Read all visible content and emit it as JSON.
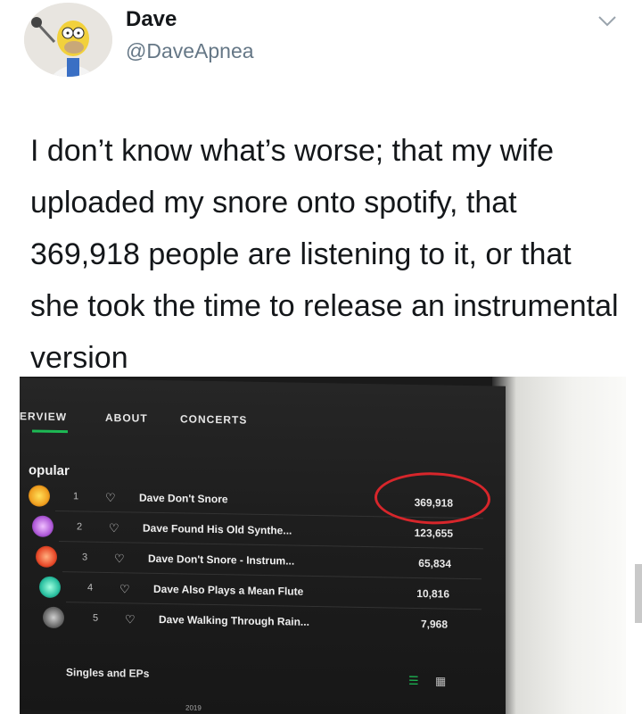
{
  "tweet": {
    "name": "Dave",
    "handle": "@DaveApnea",
    "text": "I don’t know what’s worse; that my wife uploaded my snore onto spotify, that 369,918 people are listening to it, or that she took the time to release an instrumental version"
  },
  "spotify": {
    "tabs": [
      "ERVIEW",
      "ABOUT",
      "CONCERTS"
    ],
    "section_title": "opular",
    "tracks": [
      {
        "num": "1",
        "title": "Dave Don't Snore",
        "plays": "369,918",
        "art_color": "#f0a020"
      },
      {
        "num": "2",
        "title": "Dave Found His Old Synthe...",
        "plays": "123,655",
        "art_color": "#b05ad8"
      },
      {
        "num": "3",
        "title": "Dave Don't Snore - Instrum...",
        "plays": "65,834",
        "art_color": "#e84a2a"
      },
      {
        "num": "4",
        "title": "Dave Also Plays a Mean Flute",
        "plays": "10,816",
        "art_color": "#2ac0a0"
      },
      {
        "num": "5",
        "title": "Dave Walking Through Rain...",
        "plays": "7,968",
        "art_color": "#6a6a6a"
      }
    ],
    "singles_label": "Singles and EPs",
    "year": "2019",
    "highlight_color": "#d7262b",
    "accent_color": "#1db954"
  }
}
